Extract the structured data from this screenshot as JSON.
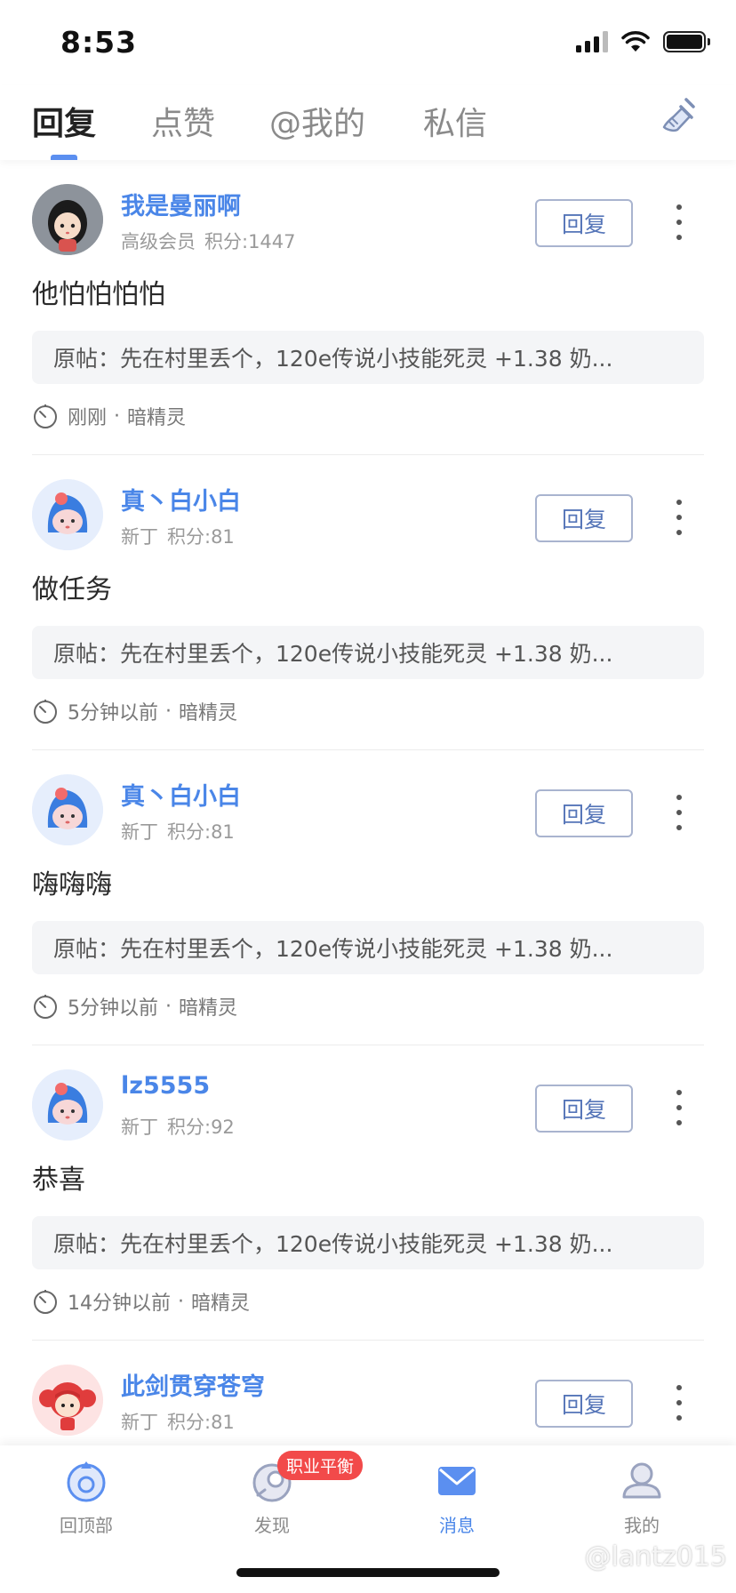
{
  "status_bar": {
    "time": "8:53"
  },
  "tabs": [
    {
      "label": "回复",
      "active": true
    },
    {
      "label": "点赞",
      "active": false
    },
    {
      "label": "@我的",
      "active": false
    },
    {
      "label": "私信",
      "active": false
    }
  ],
  "header": {
    "clear_icon": "broom-icon"
  },
  "items": [
    {
      "user": "我是曼丽啊",
      "level": "高级会员",
      "score": "积分:1447",
      "comment": "他怕怕怕怕",
      "origin": "原帖：先在村里丢个，120e传说小技能死灵 +1.38 奶...",
      "time": "刚刚",
      "forum": "暗精灵",
      "reply_label": "回复",
      "avatar": "girl-avatar"
    },
    {
      "user": "真丶白小白",
      "level": "新丁",
      "score": "积分:81",
      "comment": "做任务",
      "origin": "原帖：先在村里丢个，120e传说小技能死灵 +1.38 奶...",
      "time": "5分钟以前",
      "forum": "暗精灵",
      "reply_label": "回复",
      "avatar": "blue-mascot-avatar"
    },
    {
      "user": "真丶白小白",
      "level": "新丁",
      "score": "积分:81",
      "comment": "嗨嗨嗨",
      "origin": "原帖：先在村里丢个，120e传说小技能死灵 +1.38 奶...",
      "time": "5分钟以前",
      "forum": "暗精灵",
      "reply_label": "回复",
      "avatar": "blue-mascot-avatar"
    },
    {
      "user": "lz5555",
      "level": "新丁",
      "score": "积分:92",
      "comment": "恭喜",
      "origin": "原帖：先在村里丢个，120e传说小技能死灵 +1.38 奶...",
      "time": "14分钟以前",
      "forum": "暗精灵",
      "reply_label": "回复",
      "avatar": "blue-mascot-avatar"
    },
    {
      "user": "此剑贯穿苍穹",
      "level": "新丁",
      "score": "积分:81",
      "comment": "",
      "origin": "",
      "time": "",
      "forum": "",
      "reply_label": "回复",
      "avatar": "red-hair-avatar"
    }
  ],
  "bottom_nav": [
    {
      "label": "回顶部",
      "icon": "back-to-top-icon",
      "active": false
    },
    {
      "label": "发现",
      "icon": "discover-icon",
      "active": false,
      "badge": "职业平衡"
    },
    {
      "label": "消息",
      "icon": "message-icon",
      "active": true
    },
    {
      "label": "我的",
      "icon": "profile-icon",
      "active": false
    }
  ],
  "watermark": "@lantz015",
  "colors": {
    "accent": "#4a86e8",
    "badge": "#f24a4a",
    "origin_bg": "#f4f5f7"
  }
}
